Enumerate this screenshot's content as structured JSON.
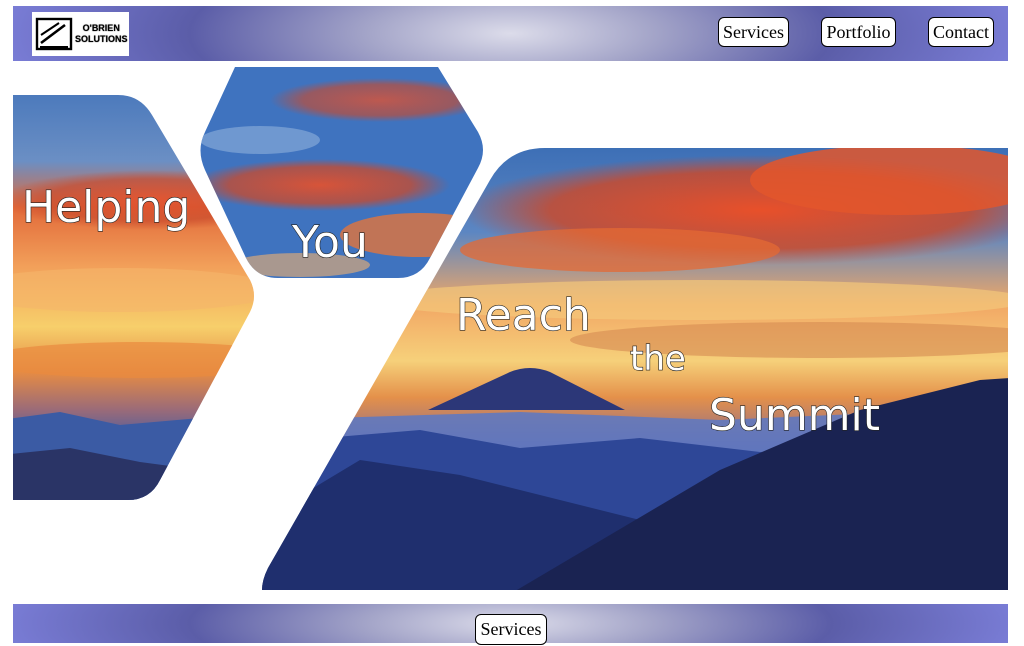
{
  "brand": {
    "line1": "O'BRIEN",
    "line2": "SOLUTIONS"
  },
  "nav": {
    "services": "Services",
    "portfolio": "Portfolio",
    "contact": "Contact"
  },
  "hero": {
    "word1": "Helping",
    "word2": "You",
    "word3": "Reach",
    "word4": "the",
    "word5": "Summit"
  },
  "footer": {
    "services": "Services"
  }
}
